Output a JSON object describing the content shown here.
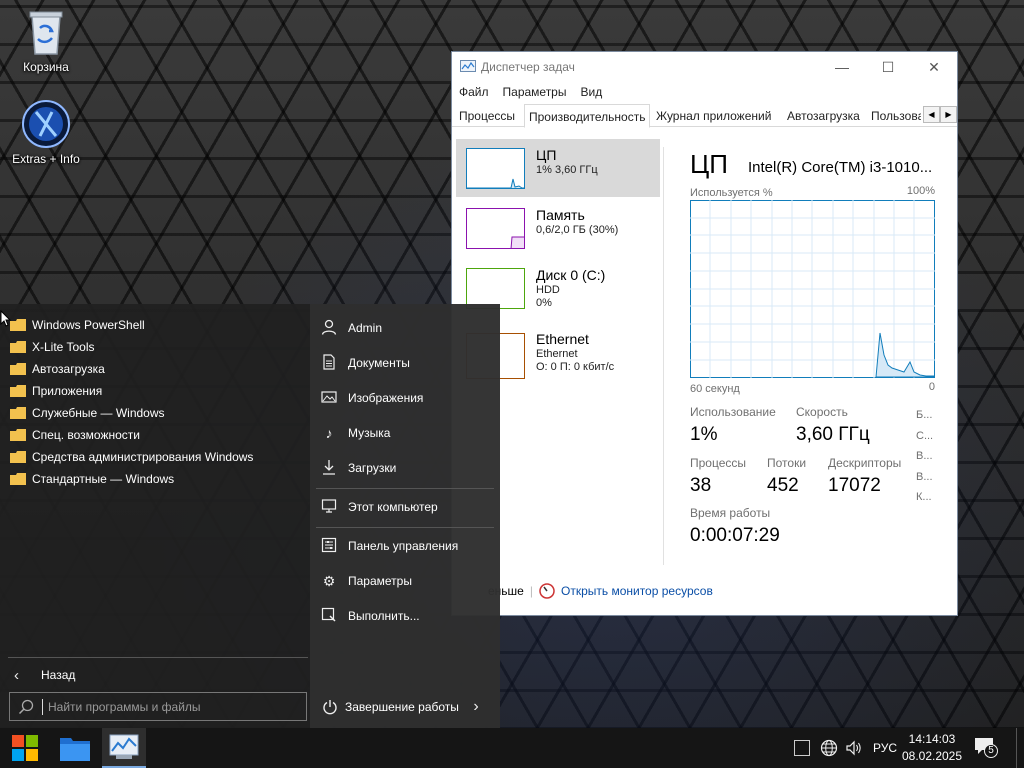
{
  "desktop": {
    "icons": [
      {
        "label": "Корзина"
      },
      {
        "label": "Extras + Info"
      }
    ]
  },
  "taskmgr": {
    "title": "Диспетчер задач",
    "window_buttons": {
      "minimize": "—",
      "maximize": "☐",
      "close": "✕"
    },
    "menu": [
      "Файл",
      "Параметры",
      "Вид"
    ],
    "tabs": [
      "Процессы",
      "Производительность",
      "Журнал приложений",
      "Автозагрузка",
      "Пользова"
    ],
    "active_tab": "Производительность",
    "resources": [
      {
        "name": "ЦП",
        "line1": "1% 3,60 ГГц",
        "line2": ""
      },
      {
        "name": "Память",
        "line1": "0,6/2,0 ГБ (30%)",
        "line2": ""
      },
      {
        "name": "Диск 0 (C:)",
        "line1": "HDD",
        "line2": "0%"
      },
      {
        "name": "Ethernet",
        "line1": "Ethernet",
        "line2": "О: 0 П: 0 кбит/с"
      }
    ],
    "detail": {
      "title": "ЦП",
      "cpu_name": "Intel(R) Core(TM) i3-1010...",
      "graph_label_left": "Используется %",
      "graph_label_right": "100%",
      "time_left": "60 секунд",
      "time_right": "0",
      "usage_label": "Использование",
      "usage_value": "1%",
      "speed_label": "Скорость",
      "speed_value": "3,60 ГГц",
      "processes_label": "Процессы",
      "processes_value": "38",
      "threads_label": "Потоки",
      "threads_value": "452",
      "handles_label": "Дескрипторы",
      "handles_value": "17072",
      "uptime_label": "Время работы",
      "uptime_value": "0:00:07:29",
      "side_letters": [
        "Б...",
        "С...",
        "В...",
        "В...",
        "К..."
      ]
    },
    "footer": {
      "less_details": "еньше",
      "resmon_link": "Открыть монитор ресурсов"
    }
  },
  "start_menu": {
    "programs": [
      "Windows PowerShell",
      "X-Lite Tools",
      "Автозагрузка",
      "Приложения",
      "Служебные — Windows",
      "Спец. возможности",
      "Средства администрирования Windows",
      "Стандартные — Windows"
    ],
    "places": [
      {
        "label": "Admin",
        "icon": "user-icon"
      },
      {
        "label": "Документы",
        "icon": "documents-icon"
      },
      {
        "label": "Изображения",
        "icon": "pictures-icon"
      },
      {
        "label": "Музыка",
        "icon": "music-icon"
      },
      {
        "label": "Загрузки",
        "icon": "downloads-icon"
      },
      {
        "label": "Этот компьютер",
        "icon": "computer-icon"
      },
      {
        "label": "Панель управления",
        "icon": "control-panel-icon"
      },
      {
        "label": "Параметры",
        "icon": "gear-icon"
      },
      {
        "label": "Выполнить...",
        "icon": "run-icon"
      }
    ],
    "back_label": "Назад",
    "search_placeholder": "Найти программы и файлы",
    "shutdown_label": "Завершение работы"
  },
  "taskbar": {
    "lang": "РУС",
    "time": "14:14:03",
    "date": "08.02.2025",
    "notification_count": "5"
  },
  "colors": {
    "cpu_accent": "#117dbb",
    "memory_accent": "#8b12ae",
    "disk_accent": "#4da60c",
    "ethernet_accent": "#a74f01",
    "link": "#0a4ea6"
  }
}
